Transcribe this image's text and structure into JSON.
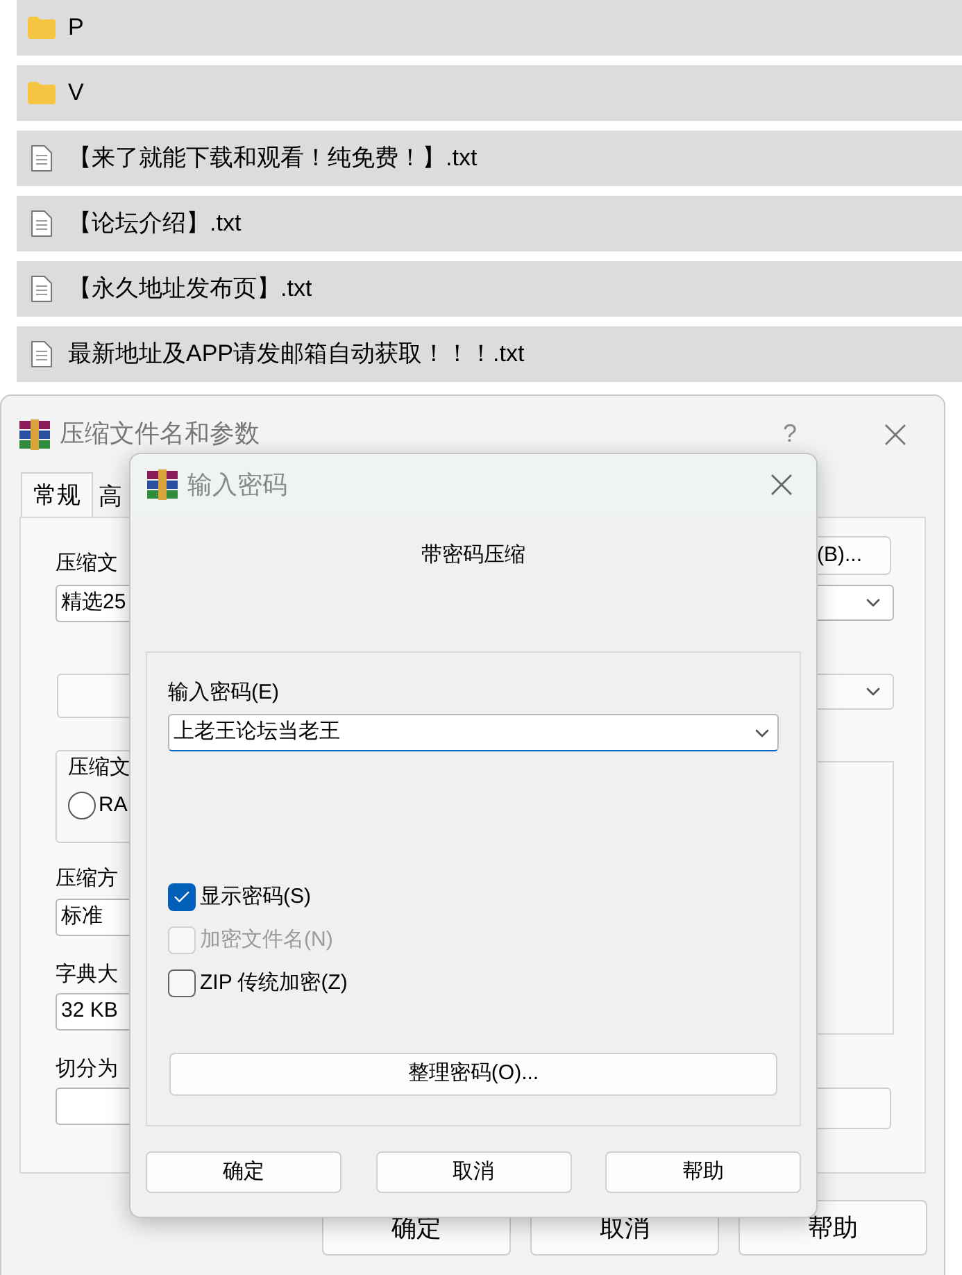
{
  "file_list": [
    {
      "kind": "folder",
      "name": "P"
    },
    {
      "kind": "folder",
      "name": "V"
    },
    {
      "kind": "text",
      "name": "【来了就能下载和观看！纯免费！】.txt"
    },
    {
      "kind": "text",
      "name": "【论坛介绍】.txt"
    },
    {
      "kind": "text",
      "name": "【永久地址发布页】.txt"
    },
    {
      "kind": "text",
      "name": "最新地址及APP请发邮箱自动获取！！！.txt"
    }
  ],
  "compress_dialog": {
    "title": "压缩文件名和参数",
    "help": "?",
    "tabs": [
      {
        "label": "常规",
        "selected": true
      },
      {
        "label": "高",
        "selected": false
      }
    ],
    "archive_name_label": "压缩文",
    "archive_name_value": "精选25",
    "browse_button": "(B)...",
    "format_group_label": "压缩文",
    "format_option": {
      "label": "RA",
      "selected": false
    },
    "method_label": "压缩方",
    "method_value": "标准",
    "dictionary_label": "字典大",
    "dictionary_value": "32 KB",
    "split_label": "切分为",
    "buttons": [
      "确定",
      "取消",
      "帮助"
    ]
  },
  "password_dialog": {
    "title": "输入密码",
    "heading": "带密码压缩",
    "password_label": "输入密码(E)",
    "password_value": "上老王论坛当老王",
    "options": [
      {
        "label": "显示密码(S)",
        "checked": true,
        "disabled": false
      },
      {
        "label": "加密文件名(N)",
        "checked": false,
        "disabled": true
      },
      {
        "label": "ZIP 传统加密(Z)",
        "checked": false,
        "disabled": false
      }
    ],
    "organize_button": "整理密码(O)...",
    "buttons": [
      "确定",
      "取消",
      "帮助"
    ]
  }
}
